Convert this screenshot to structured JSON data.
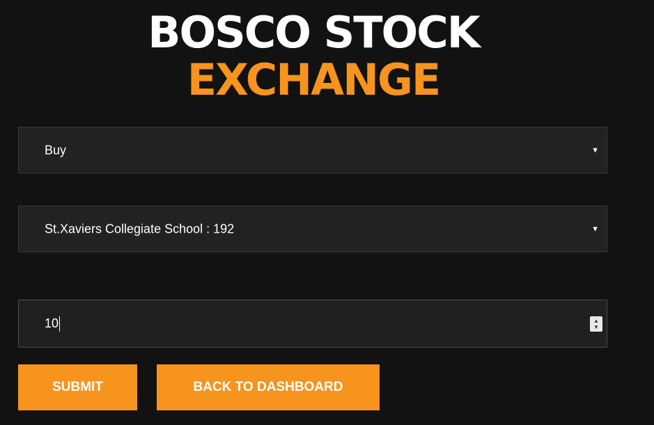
{
  "header": {
    "title_line1": "BOSCO STOCK",
    "title_line2": "EXCHANGE"
  },
  "form": {
    "transaction_type": {
      "selected": "Buy"
    },
    "stock": {
      "selected": "St.Xaviers Collegiate School : 192"
    },
    "quantity": {
      "value": "10"
    }
  },
  "buttons": {
    "submit_label": "SUBMIT",
    "back_label": "BACK TO DASHBOARD"
  },
  "icons": {
    "dropdown": "caret-down-icon",
    "stepper": "number-stepper-icon"
  },
  "colors": {
    "background": "#121212",
    "accent": "#f7941d",
    "field": "#222222",
    "text": "#ffffff"
  }
}
